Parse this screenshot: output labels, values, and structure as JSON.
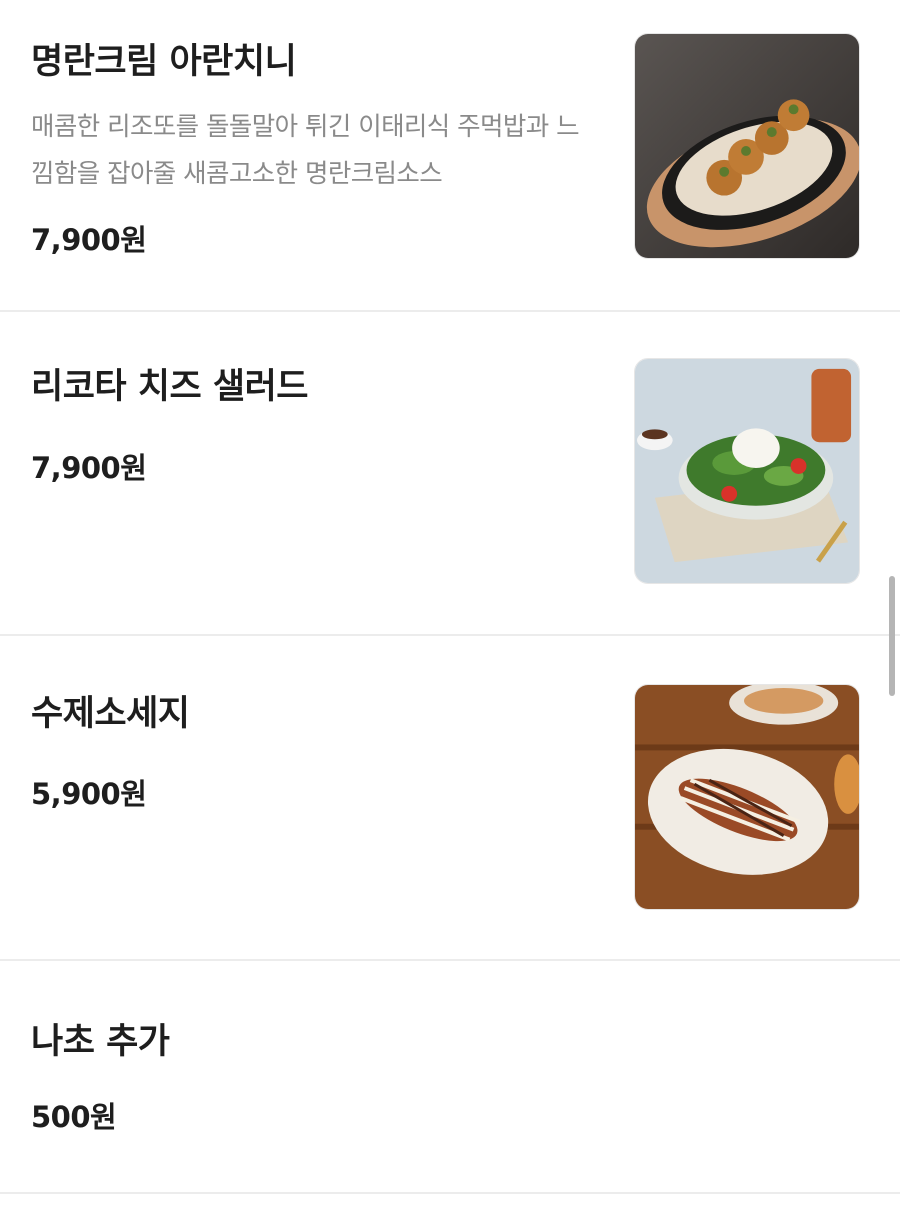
{
  "menu": {
    "items": [
      {
        "name": "명란크림 아란치니",
        "description": "매콤한 리조또를 돌돌말아 튀긴 이태리식 주먹밥과 느낌함을 잡아줄 새콤고소한 명란크림소스",
        "price": "7,900원",
        "image": "arancini-photo"
      },
      {
        "name": "리코타 치즈 샐러드",
        "price": "7,900원",
        "image": "ricotta-salad-photo"
      },
      {
        "name": "수제소세지",
        "price": "5,900원",
        "image": "homemade-sausage-photo"
      },
      {
        "name": "나초 추가",
        "price": "500원"
      }
    ]
  },
  "colors": {
    "text": "#1e1e1e",
    "description": "#8a8a8a",
    "divider": "#ececec",
    "scrollbar": "#b5b5b5"
  }
}
